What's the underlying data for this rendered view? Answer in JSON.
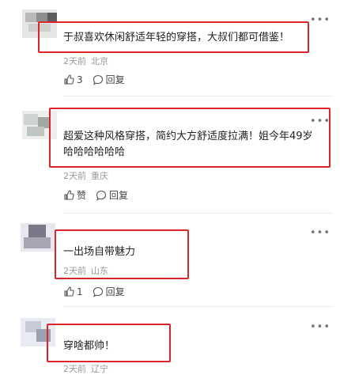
{
  "comments": [
    {
      "text_lines": [
        "于叔喜欢休闲舒适年轻的穿搭，大叔们都可借鉴！"
      ],
      "time": "2天前",
      "location": "北京",
      "like_count": "3",
      "reply_label": "回复"
    },
    {
      "text_lines": [
        "超爱这种风格穿搭，简约大方舒适度拉满！姐今年49岁",
        "哈哈哈哈哈哈"
      ],
      "time": "2天前",
      "location": "重庆",
      "like_count": "赞",
      "reply_label": "回复"
    },
    {
      "text_lines": [
        "一出场自带魅力"
      ],
      "time": "2天前",
      "location": "山东",
      "like_count": "1",
      "reply_label": "回复"
    },
    {
      "text_lines": [
        "穿啥都帅！"
      ],
      "time": "2天前",
      "location": "辽宁",
      "like_count": "",
      "reply_label": ""
    }
  ],
  "icons": {
    "like": "thumbs-up-icon",
    "reply": "comment-bubble-icon",
    "more": "more-dots-icon"
  },
  "colors": {
    "highlight_border": "#d9252b",
    "meta_text": "#999999"
  }
}
